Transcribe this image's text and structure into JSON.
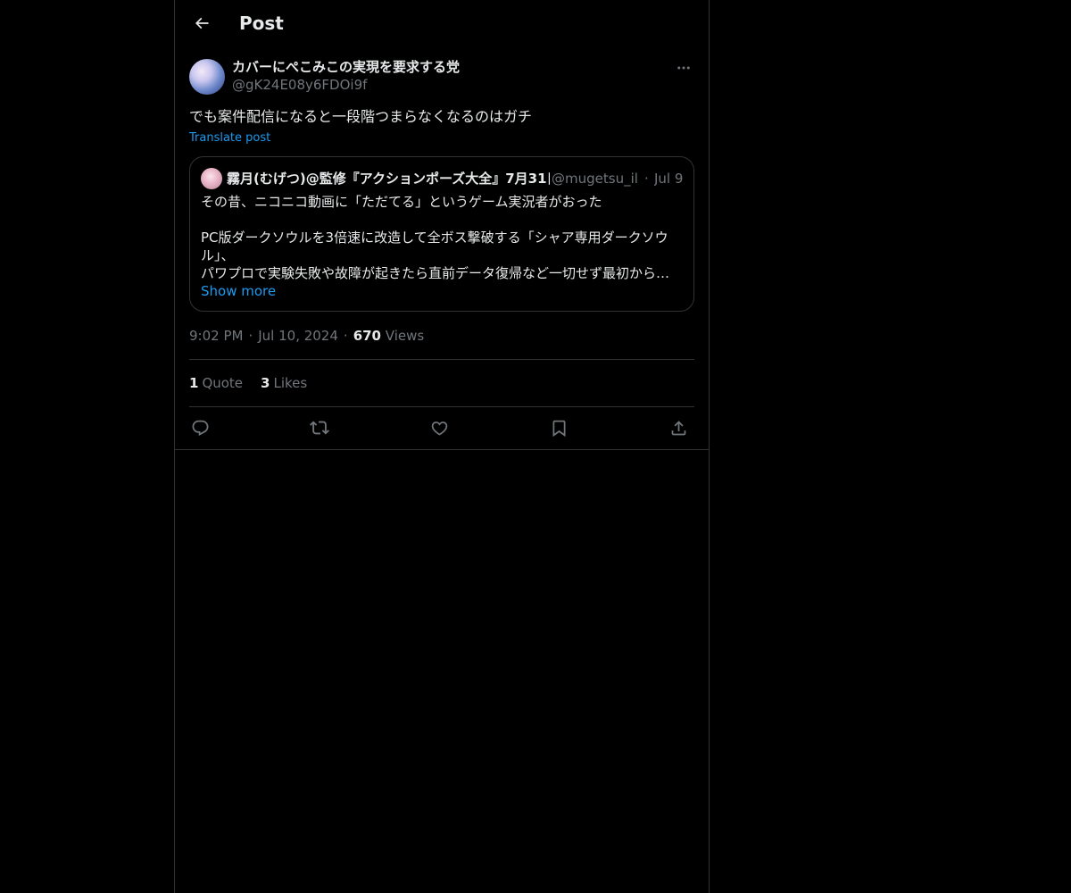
{
  "header": {
    "title": "Post",
    "back_icon": "arrow-left-icon"
  },
  "post": {
    "author": {
      "display_name": "カバーにぺこみこの実現を要求する党",
      "handle": "@gK24E08y6FDOi9f"
    },
    "more_icon": "more-horizontal-icon",
    "text": "でも案件配信になると一段階つまらなくなるのはガチ",
    "translate_label": "Translate post",
    "quote": {
      "author_name": "霧月(むげつ)@監修『アクションポーズ大全』7月31日",
      "author_handle": "@mugetsu_ill",
      "dot": "·",
      "date": "Jul 9",
      "lines": [
        "その昔、ニコニコ動画に「ただてる」というゲーム実況者がおった",
        "",
        "PC版ダークソウルを3倍速に改造して全ボス撃破する「シャア専用ダークソウル」、",
        "パワプロで実験失敗や故障が起きたら直前データ復帰など一切せず最初からやり直す"
      ],
      "show_more": "Show more"
    },
    "meta": {
      "time": "9:02 PM",
      "date": "Jul 10, 2024",
      "views_count": "670",
      "views_label": "Views",
      "sep": "·"
    },
    "stats": {
      "quotes_count": "1",
      "quotes_label": "Quote",
      "likes_count": "3",
      "likes_label": "Likes"
    },
    "actions": [
      "reply-icon",
      "repost-icon",
      "like-icon",
      "bookmark-icon",
      "share-icon"
    ]
  },
  "colors": {
    "background": "#000000",
    "text": "#e7e9ea",
    "muted": "#71767b",
    "accent": "#1d9bf0",
    "border": "#2f3336"
  }
}
